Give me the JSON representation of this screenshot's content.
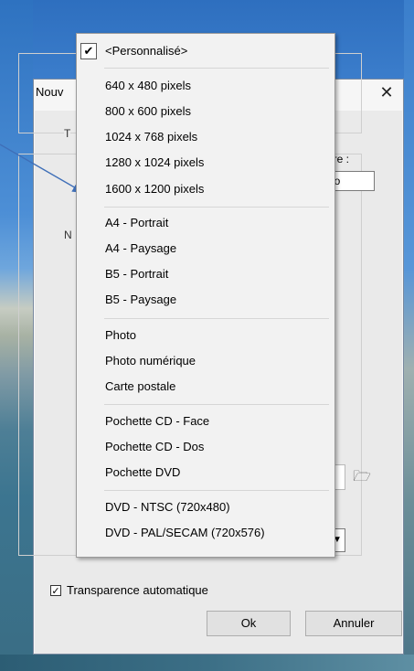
{
  "dialog": {
    "title": "Nouv",
    "close_icon": "close-icon",
    "group1_mark": "T",
    "group2_mark": "N",
    "directory_label": "ire :",
    "directory_value": "lo",
    "folder_icon": "open-folder-icon",
    "transparency_checked": true,
    "transparency_label": "Transparence automatique",
    "ok_label": "Ok",
    "cancel_label": "Annuler"
  },
  "menu": {
    "checked_item": "<Personnalisé>",
    "groups": [
      [
        "<Personnalisé>"
      ],
      [
        "640 x 480 pixels",
        "800 x 600 pixels",
        "1024 x 768 pixels",
        "1280 x 1024 pixels",
        "1600 x 1200 pixels"
      ],
      [
        "A4 - Portrait",
        "A4 - Paysage",
        "B5 - Portrait",
        "B5 - Paysage"
      ],
      [
        "Photo",
        "Photo numérique",
        "Carte postale"
      ],
      [
        "Pochette CD - Face",
        "Pochette CD - Dos",
        "Pochette DVD"
      ],
      [
        "DVD - NTSC (720x480)",
        "DVD - PAL/SECAM (720x576)"
      ]
    ]
  },
  "colors": {
    "desktop_blue": "#2a6ab5",
    "menu_bg": "#f2f2f2",
    "arrow": "#3f6fb8"
  }
}
